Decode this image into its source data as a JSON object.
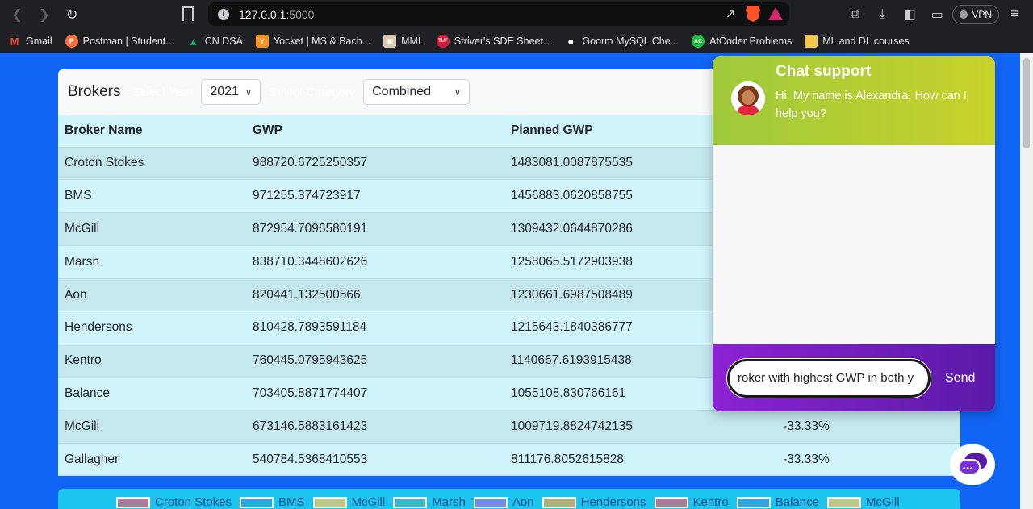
{
  "browser": {
    "url_host": "127.0.0.1",
    "url_port": ":5000",
    "vpn_label": "VPN"
  },
  "bookmarks": [
    {
      "label": "Gmail",
      "icon": "gmail-icon",
      "color": "#ea4335",
      "glyph": "M"
    },
    {
      "label": "Postman | Student...",
      "icon": "postman-icon",
      "color": "#ff6c37",
      "glyph": "P"
    },
    {
      "label": "CN DSA",
      "icon": "drive-icon",
      "color": "#1fa463",
      "glyph": "▲"
    },
    {
      "label": "Yocket | MS & Bach...",
      "icon": "yocket-icon",
      "color": "#f79420",
      "glyph": "Y"
    },
    {
      "label": "MML",
      "icon": "mml-icon",
      "color": "#d9c9b0",
      "glyph": "▣"
    },
    {
      "label": "Striver's SDE Sheet...",
      "icon": "tuf-icon",
      "color": "#d81b3a",
      "glyph": "TUF"
    },
    {
      "label": "Goorm MySQL Che...",
      "icon": "github-icon",
      "color": "#ffffff",
      "glyph": "●"
    },
    {
      "label": "AtCoder Problems",
      "icon": "atcoder-icon",
      "color": "#22bb44",
      "glyph": "AC"
    },
    {
      "label": "ML and DL courses",
      "icon": "folder-icon",
      "color": "#f2c94c",
      "glyph": ""
    }
  ],
  "card": {
    "title": "Brokers",
    "year_label": "Select Year",
    "year_value": "2021",
    "category_label": "Select Category",
    "category_value": "Combined"
  },
  "table": {
    "headers": [
      "Broker Name",
      "GWP",
      "Planned GWP",
      ""
    ],
    "rows": [
      [
        "Croton Stokes",
        "988720.6725250357",
        "1483081.0087875535",
        ""
      ],
      [
        "BMS",
        "971255.374723917",
        "1456883.0620858755",
        ""
      ],
      [
        "McGill",
        "872954.7096580191",
        "1309432.0644870286",
        ""
      ],
      [
        "Marsh",
        "838710.3448602626",
        "1258065.5172903938",
        ""
      ],
      [
        "Aon",
        "820441.132500566",
        "1230661.6987508489",
        ""
      ],
      [
        "Hendersons",
        "810428.7893591184",
        "1215643.1840386777",
        ""
      ],
      [
        "Kentro",
        "760445.0795943625",
        "1140667.6193915438",
        ""
      ],
      [
        "Balance",
        "703405.8871774407",
        "1055108.830766161",
        ""
      ],
      [
        "McGill",
        "673146.5883161423",
        "1009719.8824742135",
        "-33.33%"
      ],
      [
        "Gallagher",
        "540784.5368410553",
        "811176.8052615828",
        "-33.33%"
      ]
    ]
  },
  "legend": [
    {
      "label": "Croton Stokes",
      "color": "#b07a9c"
    },
    {
      "label": "BMS",
      "color": "#2aa6e0"
    },
    {
      "label": "McGill",
      "color": "#b8c98a"
    },
    {
      "label": "Marsh",
      "color": "#34b8cc"
    },
    {
      "label": "Aon",
      "color": "#6e8ef0"
    },
    {
      "label": "Hendersons",
      "color": "#b5ad7c"
    },
    {
      "label": "Kentro",
      "color": "#b07a9c"
    },
    {
      "label": "Balance",
      "color": "#2aa6e0"
    },
    {
      "label": "McGill",
      "color": "#b8c98a"
    }
  ],
  "chat": {
    "title": "Chat support",
    "greeting": "Hi. My name is Alexandra. How can I help you?",
    "input_value": "roker with highest GWP in both y",
    "send_label": "Send"
  }
}
